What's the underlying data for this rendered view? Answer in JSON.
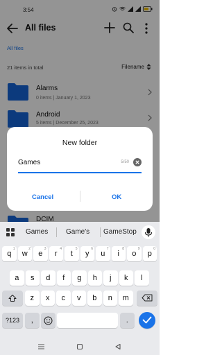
{
  "status": {
    "time": "3:54",
    "battery_color": "#f2c200"
  },
  "appbar": {
    "title": "All files",
    "icons": [
      "back-arrow-icon",
      "plus-icon",
      "search-icon",
      "more-icon"
    ]
  },
  "breadcrumb": "All files",
  "list": {
    "count": "21 items in total",
    "sort_label": "Filename",
    "rows": [
      {
        "name": "Alarms",
        "meta": "0 items  |  January 1, 2023"
      },
      {
        "name": "Android",
        "meta": "5 items  |  December 25, 2023"
      },
      {
        "name": "DCIM",
        "meta": ""
      }
    ]
  },
  "dialog": {
    "title": "New folder",
    "input_value": "Games",
    "counter": "5/50",
    "cancel_label": "Cancel",
    "ok_label": "OK"
  },
  "keyboard": {
    "suggestions": [
      "Games",
      "Game's",
      "GameStop"
    ],
    "row1": [
      "q",
      "w",
      "e",
      "r",
      "t",
      "y",
      "u",
      "i",
      "o",
      "p"
    ],
    "row1_hints": [
      "1",
      "2",
      "3",
      "4",
      "5",
      "6",
      "7",
      "8",
      "9",
      "0"
    ],
    "row2": [
      "a",
      "s",
      "d",
      "f",
      "g",
      "h",
      "j",
      "k",
      "l"
    ],
    "row3": [
      "z",
      "x",
      "c",
      "v",
      "b",
      "n",
      "m"
    ],
    "symbols_label": "?123",
    "comma": ",",
    "period": "."
  },
  "colors": {
    "accent": "#1a73e8",
    "folder": "#1565d8"
  }
}
